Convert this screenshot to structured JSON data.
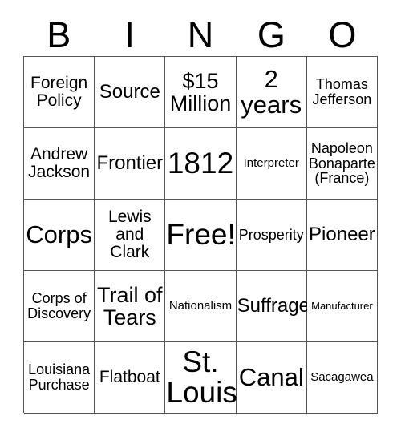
{
  "card": {
    "title": "BINGO",
    "header_letters": [
      "B",
      "I",
      "N",
      "G",
      "O"
    ],
    "free_space_label": "Free!",
    "border_color": "#555555",
    "text_color": "#000000",
    "background_color": "#ffffff",
    "rows": [
      [
        {
          "text": "Foreign\nPolicy",
          "size": "fs-lg"
        },
        {
          "text": "Source",
          "size": "fs-xl"
        },
        {
          "text": "$15\nMillion",
          "size": "fs-2xl"
        },
        {
          "text": "2\nyears",
          "size": "fs-3xl"
        },
        {
          "text": "Thomas\nJefferson",
          "size": "fs-md"
        }
      ],
      [
        {
          "text": "Andrew\nJackson",
          "size": "fs-lg"
        },
        {
          "text": "Frontier",
          "size": "fs-xl"
        },
        {
          "text": "1812",
          "size": "fs-4xl"
        },
        {
          "text": "Interpreter",
          "size": "fs-sm"
        },
        {
          "text": "Napoleon\nBonaparte\n(France)",
          "size": "fs-md"
        }
      ],
      [
        {
          "text": "Corps",
          "size": "fs-3xl"
        },
        {
          "text": "Lewis\nand\nClark",
          "size": "fs-lg"
        },
        {
          "text": "Free!",
          "size": "fs-4xl"
        },
        {
          "text": "Prosperity",
          "size": "fs-md"
        },
        {
          "text": "Pioneer",
          "size": "fs-xl"
        }
      ],
      [
        {
          "text": "Corps of\nDiscovery",
          "size": "fs-md"
        },
        {
          "text": "Trail of\nTears",
          "size": "fs-2xl"
        },
        {
          "text": "Nationalism",
          "size": "fs-sm"
        },
        {
          "text": "Suffrage",
          "size": "fs-xl"
        },
        {
          "text": "Manufacturer",
          "size": "fs-xs"
        }
      ],
      [
        {
          "text": "Louisiana\nPurchase",
          "size": "fs-md"
        },
        {
          "text": "Flatboat",
          "size": "fs-lg"
        },
        {
          "text": "St.\nLouis",
          "size": "fs-4xl"
        },
        {
          "text": "Canal",
          "size": "fs-3xl"
        },
        {
          "text": "Sacagawea",
          "size": "fs-sm"
        }
      ]
    ]
  }
}
